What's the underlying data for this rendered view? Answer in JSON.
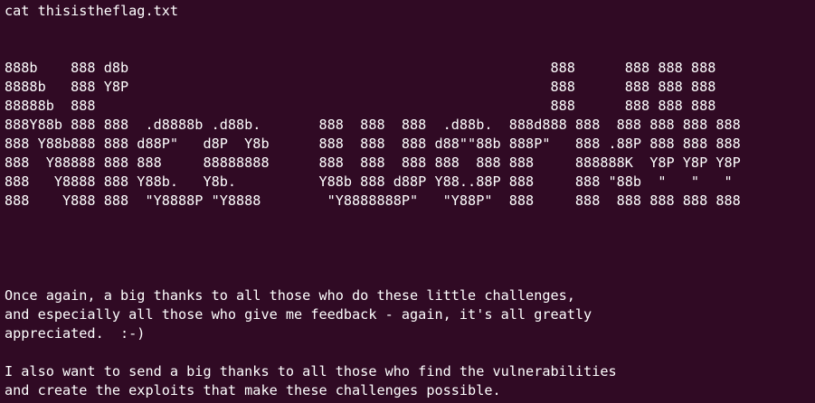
{
  "terminal": {
    "command": "cat thisistheflag.txt",
    "ascii_art": [
      "888b    888 d8b                                                   888      888 888 888",
      "8888b   888 Y8P                                                   888      888 888 888",
      "88888b  888                                                       888      888 888 888",
      "888Y88b 888 888  .d8888b .d88b.       888  888  888  .d88b.  888d888 888  888 888 888 888",
      "888 Y88b888 888 d88P\"   d8P  Y8b      888  888  888 d88\"\"88b 888P\"   888 .88P 888 888 888",
      "888  Y88888 888 888     88888888      888  888  888 888  888 888     888888K  Y8P Y8P Y8P",
      "888   Y8888 888 Y88b.   Y8b.          Y88b 888 d88P Y88..88P 888     888 \"88b  \"   \"   \"",
      "888    Y888 888  \"Y8888P \"Y8888        \"Y8888888P\"   \"Y88P\"  888     888  888 888 888 888"
    ],
    "message": [
      "Once again, a big thanks to all those who do these little challenges,",
      "and especially all those who give me feedback - again, it's all greatly",
      "appreciated.  :-)",
      "I also want to send a big thanks to all those who find the vulnerabilities",
      "and create the exploits that make these challenges possible."
    ]
  },
  "colors": {
    "background": "#300a24",
    "foreground": "#ffffff"
  }
}
